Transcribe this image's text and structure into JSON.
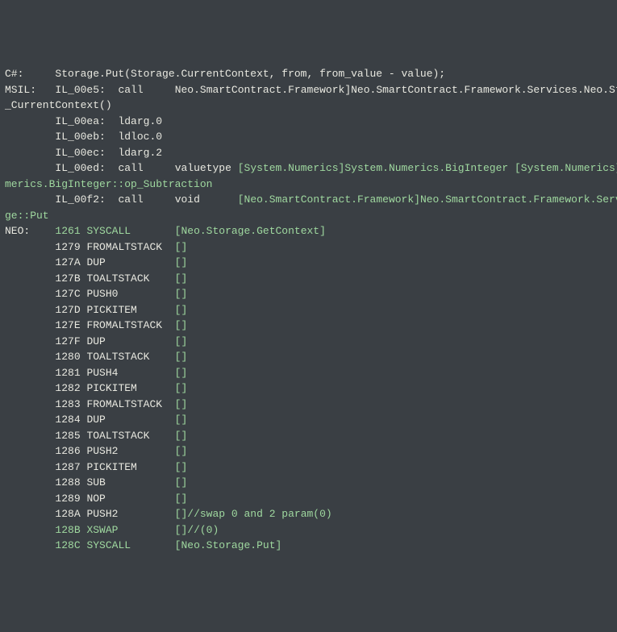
{
  "header": {
    "csLine": {
      "lang": "C#:",
      "code": "Storage.Put(Storage.CurrentContext, from, from_value - value);"
    },
    "msilLines": [
      {
        "lang": "MSIL:",
        "addr": "IL_00e5:",
        "op": "call",
        "rest": "Neo.SmartContract.Framework]Neo.SmartContract.Framework.Services.Neo.Storage::get"
      },
      {
        "restOnly": "_CurrentContext()"
      },
      {
        "addr": "IL_00ea:",
        "op": "ldarg.0"
      },
      {
        "addr": "IL_00eb:",
        "op": "ldloc.0"
      },
      {
        "addr": "IL_00ec:",
        "op": "ldarg.2"
      },
      {
        "addr": "IL_00ed:",
        "op": "call",
        "kw": "valuetype",
        "sig1": "[System.Numerics]System.Numerics.BigInteger [System.Numerics]System.Nu"
      },
      {
        "sigWrap": "merics.BigInteger::op_Subtraction"
      },
      {
        "addr": "IL_00f2:",
        "op": "call",
        "kw": "void",
        "sig2": "[Neo.SmartContract.Framework]Neo.SmartContract.Framework.Services.Neo.Stora"
      },
      {
        "sigWrap": "ge::Put"
      }
    ]
  },
  "neo": {
    "lang": "NEO:",
    "rows": [
      {
        "addr": "1261",
        "op": "SYSCALL",
        "args": "[Neo.Storage.GetContext]",
        "sys": true
      },
      {
        "addr": "1279",
        "op": "FROMALTSTACK",
        "args": "[]"
      },
      {
        "addr": "127A",
        "op": "DUP",
        "args": "[]"
      },
      {
        "addr": "127B",
        "op": "TOALTSTACK",
        "args": "[]"
      },
      {
        "addr": "127C",
        "op": "PUSH0",
        "args": "[]"
      },
      {
        "addr": "127D",
        "op": "PICKITEM",
        "args": "[]"
      },
      {
        "addr": "127E",
        "op": "FROMALTSTACK",
        "args": "[]"
      },
      {
        "addr": "127F",
        "op": "DUP",
        "args": "[]"
      },
      {
        "addr": "1280",
        "op": "TOALTSTACK",
        "args": "[]"
      },
      {
        "addr": "1281",
        "op": "PUSH4",
        "args": "[]"
      },
      {
        "addr": "1282",
        "op": "PICKITEM",
        "args": "[]"
      },
      {
        "addr": "1283",
        "op": "FROMALTSTACK",
        "args": "[]"
      },
      {
        "addr": "1284",
        "op": "DUP",
        "args": "[]"
      },
      {
        "addr": "1285",
        "op": "TOALTSTACK",
        "args": "[]"
      },
      {
        "addr": "1286",
        "op": "PUSH2",
        "args": "[]"
      },
      {
        "addr": "1287",
        "op": "PICKITEM",
        "args": "[]"
      },
      {
        "addr": "1288",
        "op": "SUB",
        "args": "[]"
      },
      {
        "addr": "1289",
        "op": "NOP",
        "args": "[]"
      },
      {
        "addr": "128A",
        "op": "PUSH2",
        "args": "[]//swap 0 and 2 param(0)",
        "cmt": true
      },
      {
        "addr": "128B",
        "op": "XSWAP",
        "args": "[]//(0)",
        "sys": true,
        "cmt": true
      },
      {
        "addr": "128C",
        "op": "SYSCALL",
        "args": "[Neo.Storage.Put]",
        "sys": true
      }
    ]
  }
}
